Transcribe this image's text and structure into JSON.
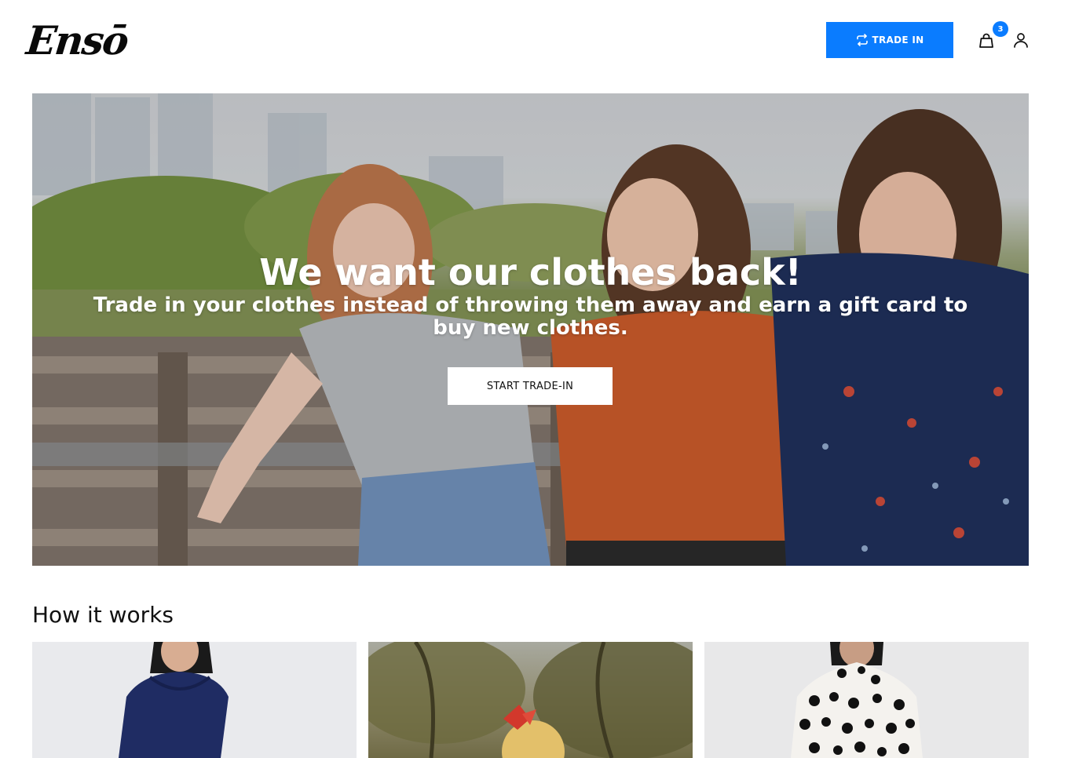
{
  "header": {
    "logo_text": "Ensō",
    "trade_in_label": "TRADE IN",
    "cart_count": "3",
    "icons": [
      "trade-arrows-icon",
      "shopping-bag-icon",
      "user-icon"
    ]
  },
  "hero": {
    "title": "We want our clothes back!",
    "subtitle": "Trade in your clothes instead of throwing them away and earn a gift card to buy new clothes.",
    "cta_label": "START TRADE-IN"
  },
  "how_it_works": {
    "title": "How it works",
    "cards": [
      {
        "image": "woman-in-navy-hoodie"
      },
      {
        "image": "girl-with-red-bow-outdoors"
      },
      {
        "image": "woman-in-polka-dot-top"
      }
    ]
  },
  "colors": {
    "accent": "#0a7cff",
    "text": "#111111",
    "background": "#ffffff"
  }
}
